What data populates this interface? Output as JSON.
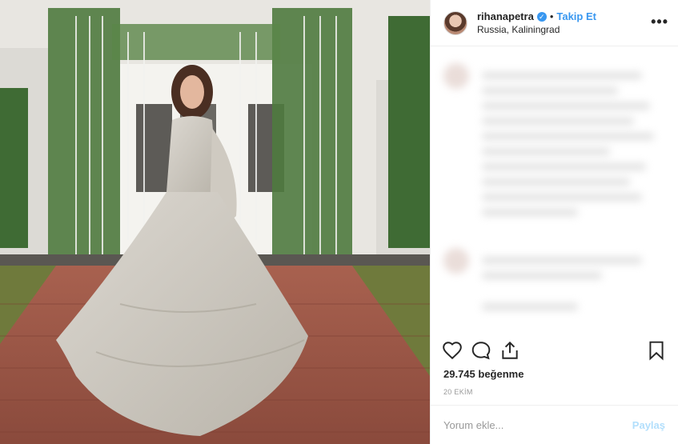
{
  "header": {
    "username": "rihanapetra",
    "follow_label": "Takip Et",
    "location": "Russia, Kaliningrad",
    "more_glyph": "•••"
  },
  "stats": {
    "likes_text": "29.745 beğenme",
    "date_text": "20 EKİM"
  },
  "comment_box": {
    "placeholder": "Yorum ekle...",
    "share_label": "Paylaş"
  },
  "icons": [
    "heart-icon",
    "comment-icon",
    "share-icon",
    "bookmark-icon",
    "verified-icon"
  ],
  "colors": {
    "accent": "#3897f0",
    "share_disabled": "#b2dffc",
    "text": "#262626"
  }
}
